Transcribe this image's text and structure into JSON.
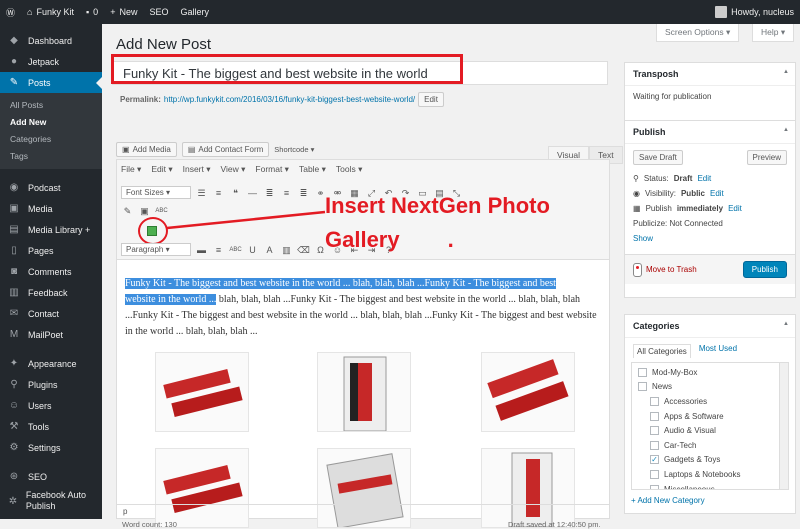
{
  "adminbar": {
    "site": "Funky Kit",
    "comments": "0",
    "new": "New",
    "seo": "SEO",
    "gallery": "Gallery",
    "howdy": "Howdy, nucleus"
  },
  "sidebar": {
    "items": [
      {
        "icon": "dashboard-icon",
        "label": "Dashboard",
        "g": "◆"
      },
      {
        "icon": "jetpack-icon",
        "label": "Jetpack",
        "g": "●"
      },
      {
        "icon": "posts-icon",
        "label": "Posts",
        "g": "✎"
      }
    ],
    "sub": [
      "All Posts",
      "Add New",
      "Categories",
      "Tags"
    ],
    "items2": [
      {
        "icon": "podcast-icon",
        "label": "Podcast",
        "g": "◉"
      },
      {
        "icon": "media-icon",
        "label": "Media",
        "g": "▣"
      },
      {
        "icon": "media-library-icon",
        "label": "Media Library +",
        "g": "▤"
      },
      {
        "icon": "pages-icon",
        "label": "Pages",
        "g": "▯"
      },
      {
        "icon": "comments-icon",
        "label": "Comments",
        "g": "◙"
      },
      {
        "icon": "feedback-icon",
        "label": "Feedback",
        "g": "▥"
      },
      {
        "icon": "contact-icon",
        "label": "Contact",
        "g": "✉"
      },
      {
        "icon": "mailpoet-icon",
        "label": "MailPoet",
        "g": "M"
      }
    ],
    "items3": [
      {
        "icon": "appearance-icon",
        "label": "Appearance",
        "g": "✦"
      },
      {
        "icon": "plugins-icon",
        "label": "Plugins",
        "g": "⚲"
      },
      {
        "icon": "users-icon",
        "label": "Users",
        "g": "☺"
      },
      {
        "icon": "tools-icon",
        "label": "Tools",
        "g": "⚒"
      },
      {
        "icon": "settings-icon",
        "label": "Settings",
        "g": "⚙"
      }
    ],
    "items4": [
      {
        "icon": "seo-icon",
        "label": "SEO",
        "g": "⊛"
      },
      {
        "icon": "facebook-icon",
        "label": "Facebook Auto Publish",
        "g": "✲"
      }
    ]
  },
  "page": {
    "heading": "Add New Post",
    "screen_options": "Screen Options ▾",
    "help": "Help ▾"
  },
  "post": {
    "title": "Funky Kit - The biggest and best website in the world",
    "permalink_label": "Permalink:",
    "permalink_url": "http://wp.funkykit.com/2016/03/16/funky-kit-biggest-best-website-world/",
    "edit": "Edit"
  },
  "media": {
    "add_media": "Add Media",
    "add_contact": "Add Contact Form",
    "shortcode": "Shortcode ▾",
    "visual": "Visual",
    "text": "Text"
  },
  "menus": [
    "File ▾",
    "Edit ▾",
    "Insert ▾",
    "View ▾",
    "Format ▾",
    "Table ▾",
    "Tools ▾"
  ],
  "toolbar": {
    "font_sizes": "Font Sizes ▾",
    "paragraph": "Paragraph ▾"
  },
  "callout": {
    "line1": "Insert NextGen Photo",
    "line2": "Gallery",
    "dot": "."
  },
  "content": {
    "hl1": "Funky Kit - The biggest and best website in the world ... blah, blah, blah ...Funky Kit - The biggest and best",
    "hl2": "website in the world ...",
    "rest": " blah, blah, blah ...Funky Kit - The biggest and best website in the world ... blah, blah, blah ...Funky Kit - The biggest and best website in the world ... blah, blah, blah ...Funky Kit - The biggest and best website in the world ... blah, blah, blah ..."
  },
  "status": {
    "path": "p",
    "wordcount": "Word count: 130",
    "draft": "Draft saved at 12:40:50 pm."
  },
  "transposh": {
    "title": "Transposh",
    "body": "Waiting for publication"
  },
  "publish": {
    "title": "Publish",
    "save_draft": "Save Draft",
    "preview": "Preview",
    "status_label": "Status:",
    "status": "Draft",
    "visibility_label": "Visibility:",
    "visibility": "Public",
    "publish_label": "Publish",
    "publish_when": "immediately",
    "edit": "Edit",
    "publicize": "Publicize: Not Connected",
    "show": "Show",
    "trash": "Move to Trash",
    "publish_btn": "Publish"
  },
  "categories": {
    "title": "Categories",
    "tab_all": "All Categories",
    "tab_used": "Most Used",
    "items": [
      {
        "label": "Mod-My-Box",
        "checked": false,
        "indent": 0
      },
      {
        "label": "News",
        "checked": false,
        "indent": 0
      },
      {
        "label": "Accessories",
        "checked": false,
        "indent": 1
      },
      {
        "label": "Apps & Software",
        "checked": false,
        "indent": 1
      },
      {
        "label": "Audio & Visual",
        "checked": false,
        "indent": 1
      },
      {
        "label": "Car-Tech",
        "checked": false,
        "indent": 1
      },
      {
        "label": "Gadgets & Toys",
        "checked": true,
        "indent": 1
      },
      {
        "label": "Laptops & Notebooks",
        "checked": false,
        "indent": 1
      },
      {
        "label": "Miscellaneous",
        "checked": false,
        "indent": 1
      }
    ],
    "add_new": "+ Add New Category"
  }
}
